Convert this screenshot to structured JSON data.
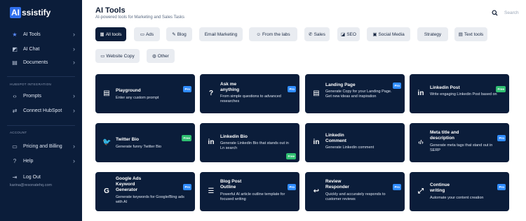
{
  "sidebar": {
    "logo_mark": "AI",
    "logo_rest": "ssistify",
    "items": [
      {
        "label": "AI Tools",
        "icon": "star-icon"
      },
      {
        "label": "AI Chat",
        "icon": "chat-icon"
      },
      {
        "label": "Documents",
        "icon": "document-icon"
      }
    ],
    "hubspot_section": "HUBSPOT INTEGRATION",
    "hubspot_items": [
      {
        "label": "Prompts",
        "icon": "code-icon"
      },
      {
        "label": "Connect HubSpot",
        "icon": "connect-icon"
      }
    ],
    "account_section": "ACCOUNT",
    "account_items": [
      {
        "label": "Pricing and Billing",
        "icon": "card-icon"
      },
      {
        "label": "Help",
        "icon": "help-icon"
      },
      {
        "label": "Log Out",
        "icon": "logout-icon"
      }
    ],
    "email": "karina@resonatehq.com"
  },
  "header": {
    "title": "AI Tools",
    "subtitle": "AI-powered tools for Marketing and Sales Tasks",
    "search_placeholder": "Search"
  },
  "filters": [
    {
      "label": "All tools",
      "icon": "grid-icon",
      "active": true
    },
    {
      "label": "Ads",
      "icon": "monitor-icon"
    },
    {
      "label": "Blog",
      "icon": "pencil-icon"
    },
    {
      "label": "Email Marketing",
      "icon": ""
    },
    {
      "label": "From the labs",
      "icon": "smile-icon"
    },
    {
      "label": "Sales",
      "icon": "phone-icon"
    },
    {
      "label": "SEO",
      "icon": "seo-icon"
    },
    {
      "label": "Social Media",
      "icon": "facebook-icon"
    },
    {
      "label": "Strategy",
      "icon": ""
    },
    {
      "label": "Text tools",
      "icon": "file-icon"
    },
    {
      "label": "Website Copy",
      "icon": "laptop-icon"
    },
    {
      "label": "Other",
      "icon": "globe-icon"
    }
  ],
  "tools": [
    {
      "title": "Playground",
      "desc": "Enter any custom prompt",
      "badge": "Pro",
      "icon": "document-icon"
    },
    {
      "title": "Ask me anything",
      "desc": "From simple questions to advanced researches",
      "badge": "Pro",
      "icon": "question-icon"
    },
    {
      "title": "Landing Page",
      "desc": "Generate Copy for your Landing Page. Get new ideas and inspiration",
      "badge": "Pro",
      "icon": "document-icon"
    },
    {
      "title": "Linkedin Post",
      "desc": "Write engaging Linkedin Post based on",
      "badge": "Free",
      "icon": "linkedin-icon"
    },
    {
      "title": "Twitter Bio",
      "desc": "Generate funny Twitter Bio",
      "badge": "Free",
      "icon": "twitter-icon"
    },
    {
      "title": "Linkedin Bio",
      "desc": "Generate Linkedin Bio that stands out in Ln search",
      "badge": "Free",
      "icon": "linkedin-icon"
    },
    {
      "title": "Linkedin Comment",
      "desc": "Generate Linkedin comment",
      "badge": "",
      "icon": "linkedin-icon"
    },
    {
      "title": "Meta title and description",
      "desc": "Generate meta tags that stand out in SERP",
      "badge": "Pro",
      "icon": "code-icon"
    },
    {
      "title": "Google Ads Keyword Generator",
      "desc": "Generate keywords for Google/Bing ads with AI",
      "badge": "Pro",
      "icon": "google-icon"
    },
    {
      "title": "Blog Post Outline",
      "desc": "Powerful AI article outline template for focused writing",
      "badge": "Pro",
      "icon": "list-icon"
    },
    {
      "title": "Review Responder",
      "desc": "Quickly and accurately responds to customer reviews",
      "badge": "Pro",
      "icon": "reply-icon"
    },
    {
      "title": "Continue writing",
      "desc": "Automate your content creation",
      "badge": "Pro",
      "icon": "expand-icon"
    }
  ],
  "colors": {
    "navy": "#0b1d3a",
    "accent": "#2f6fed",
    "pro_badge": "#2f8cff",
    "free_badge": "#2fbf71",
    "chip_bg": "#e9ecf1"
  }
}
